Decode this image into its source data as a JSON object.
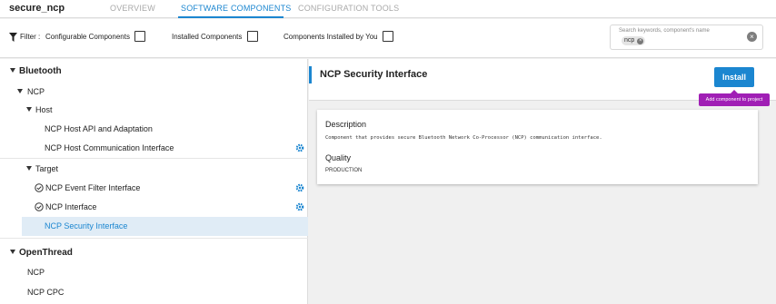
{
  "app": {
    "project_name": "secure_ncp"
  },
  "tabs": [
    {
      "label": "OVERVIEW",
      "active": false
    },
    {
      "label": "SOFTWARE COMPONENTS",
      "active": true
    },
    {
      "label": "CONFIGURATION TOOLS",
      "active": false
    }
  ],
  "filters": {
    "prefix": "Filter :",
    "configurable": {
      "label": "Configurable Components",
      "checked": false
    },
    "installed": {
      "label": "Installed Components",
      "checked": false
    },
    "installed_by_you": {
      "label": "Components Installed by You",
      "checked": false
    }
  },
  "search": {
    "placeholder": "Search keywords, component's name",
    "chip": "ncp",
    "chip_close_icon": "×",
    "clear_icon": "×"
  },
  "tree": {
    "bluetooth": "Bluetooth",
    "ncp": "NCP",
    "host": "Host",
    "host_api": "NCP Host API and Adaptation",
    "host_comm": "NCP Host Communication Interface",
    "target": "Target",
    "event_filter": "NCP Event Filter Interface",
    "ncp_interface": "NCP Interface",
    "security": "NCP Security Interface",
    "openthread": "OpenThread",
    "ot_ncp": "NCP",
    "ot_ncp_cpc": "NCP CPC"
  },
  "detail": {
    "title": "NCP Security Interface",
    "install_label": "Install",
    "tooltip": "Add component to project",
    "description_heading": "Description",
    "description": "Component that provides secure Bluetooth Network Co-Processor (NCP) communication interface.",
    "quality_heading": "Quality",
    "quality": "PRODUCTION"
  },
  "colors": {
    "accent": "#1b86d0",
    "tooltip": "#a01fb5",
    "selected_row": "#e0ecf6"
  }
}
